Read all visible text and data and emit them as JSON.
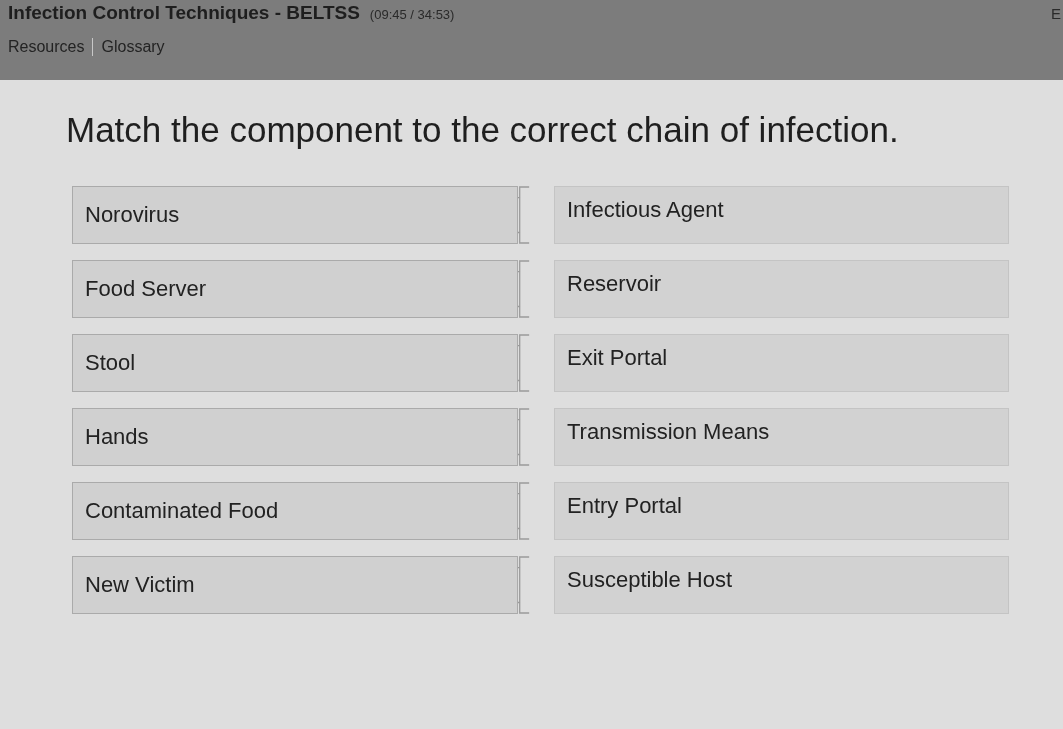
{
  "header": {
    "title": "Infection Control Techniques - BELTSS",
    "timer": "(09:45 / 34:53)",
    "edge_text": "E",
    "links": [
      {
        "label": "Resources"
      },
      {
        "label": "Glossary"
      }
    ]
  },
  "question": {
    "prompt": "Match the component to the correct chain of infection."
  },
  "matching": {
    "items": [
      {
        "label": "Norovirus"
      },
      {
        "label": "Food Server"
      },
      {
        "label": "Stool"
      },
      {
        "label": "Hands"
      },
      {
        "label": "Contaminated Food"
      },
      {
        "label": "New Victim"
      }
    ],
    "targets": [
      {
        "label": "Infectious Agent"
      },
      {
        "label": "Reservoir"
      },
      {
        "label": "Exit Portal"
      },
      {
        "label": "Transmission Means"
      },
      {
        "label": "Entry Portal"
      },
      {
        "label": "Susceptible Host"
      }
    ]
  }
}
